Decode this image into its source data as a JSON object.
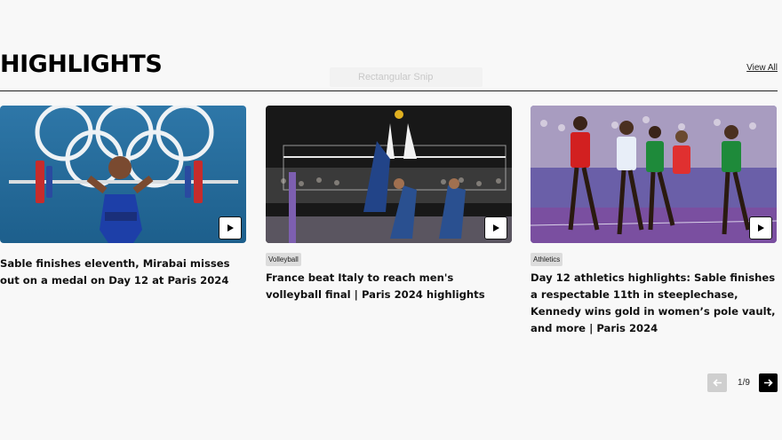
{
  "section": {
    "title": "HIGHLIGHTS",
    "view_all": "View All"
  },
  "ghost_label": "Rectangular Snip",
  "cards": [
    {
      "image": "weightlifting-olympic-rings-photo",
      "tag": "",
      "headline": "Sable finishes eleventh, Mirabai misses out on a medal on Day 12 at Paris 2024"
    },
    {
      "image": "volleyball-block-photo",
      "tag": "Volleyball",
      "headline": "France beat Italy to reach men's volleyball final | Paris 2024 highlights"
    },
    {
      "image": "steeplechase-runners-photo",
      "tag": "Athletics",
      "headline": "Day 12 athletics highlights: Sable finishes a respectable 11th in steeplechase, Kennedy wins gold in women’s pole vault, and more | Paris 2024"
    }
  ],
  "pagination": {
    "current": "1/9"
  },
  "colors": {
    "accent": "#000000",
    "tag_bg": "#dcdcdc",
    "disabled": "#cfcfcf"
  }
}
